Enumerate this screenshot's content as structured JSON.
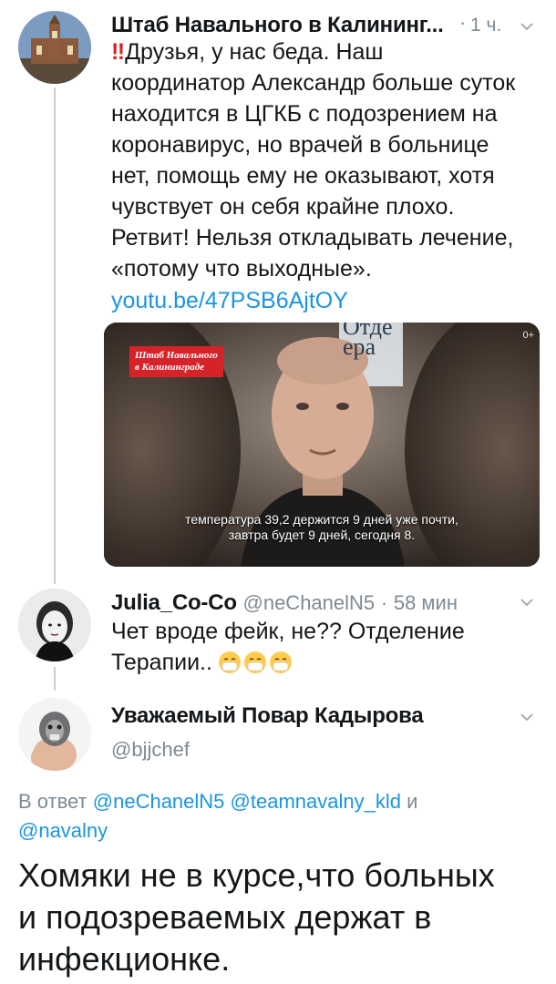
{
  "tweet1": {
    "author_name": "Штаб Навального в Калининг...",
    "time": "1 ч.",
    "emoji": "‼",
    "text_lines": [
      "Друзья, у нас беда. Наш",
      "координатор Александр больше суток",
      "находится в ЦГКБ с подозрением на",
      "коронавирус, но врачей в больнице",
      "нет, помощь ему не оказывают, хотя",
      "чувствует он себя крайне плохо.",
      "Ретвит! Нельзя откладывать лечение,",
      "«потому что выходные»."
    ],
    "link": "youtu.be/47PSB6AjtOY",
    "video": {
      "channel_badge_line1": "Штаб Навального",
      "channel_badge_line2": "в Калининграде",
      "bg_sign_line1": "Отде",
      "bg_sign_line2": "ера",
      "corner_badge": "0+",
      "subtitle_line1": "температура 39,2 держится 9 дней уже почти,",
      "subtitle_line2": "завтра будет 9 дней, сегодня 8."
    }
  },
  "tweet2": {
    "author_name": "Julia_Co-Co",
    "handle": "@neChanelN5",
    "time": "58 мин",
    "text_line1": "Чет вроде фейк, не?? Отделение",
    "text_line2": "Терапии..",
    "emojis": [
      "mask-face",
      "mask-face",
      "mask-face"
    ]
  },
  "tweet3": {
    "author_name": "Уважаемый Повар Кадырова",
    "handle": "@bjjchef",
    "reply_prefix": "В ответ",
    "reply_to_line1": [
      "@neChanelN5",
      "@teamnavalny_kld"
    ],
    "reply_and": "и",
    "reply_to_line2": "@navalny",
    "text_lines": [
      "Хомяки не в курсе,что больных",
      "и подозреваемых держат в",
      "инфекционке."
    ]
  },
  "colors": {
    "link": "#1b95e0",
    "muted": "#7f8a93",
    "text": "#14171a",
    "badge_red": "#d6232a",
    "thread_line": "#c4cfd6"
  }
}
